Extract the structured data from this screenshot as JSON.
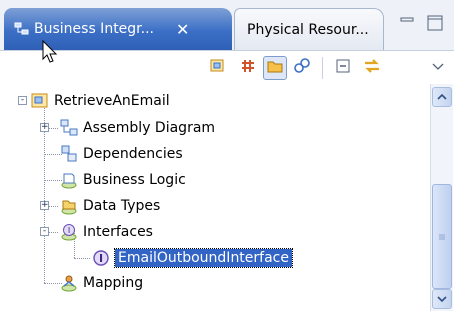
{
  "tabs": [
    {
      "label": "Business Integr...",
      "close": "✕",
      "icon": "business-integration-icon"
    },
    {
      "label": "Physical Resour...",
      "icon": "none"
    }
  ],
  "window_controls": {
    "minimize": "minimize-icon",
    "maximize": "maximize-icon"
  },
  "toolbar": {
    "buttons": [
      "open-module-icon",
      "grid-icon",
      "folder-icon",
      "link-icon",
      "collapse-all-icon",
      "sync-icon",
      "view-menu-icon"
    ]
  },
  "tree": {
    "root": "RetrieveAnEmail",
    "items": [
      {
        "label": "Assembly Diagram",
        "icon": "assembly-diagram-icon",
        "expander": "+"
      },
      {
        "label": "Dependencies",
        "icon": "dependencies-icon"
      },
      {
        "label": "Business Logic",
        "icon": "business-logic-icon"
      },
      {
        "label": "Data Types",
        "icon": "data-types-icon",
        "expander": "+"
      },
      {
        "label": "Interfaces",
        "icon": "interfaces-icon",
        "expander": "-"
      },
      {
        "label": "EmailOutboundInterface",
        "icon": "interface-icon",
        "selected": true
      },
      {
        "label": "Mapping",
        "icon": "mapping-icon"
      }
    ],
    "root_expander": "-"
  },
  "colors": {
    "selection": "#3164c4",
    "active_tab": "#3b6fc6"
  }
}
